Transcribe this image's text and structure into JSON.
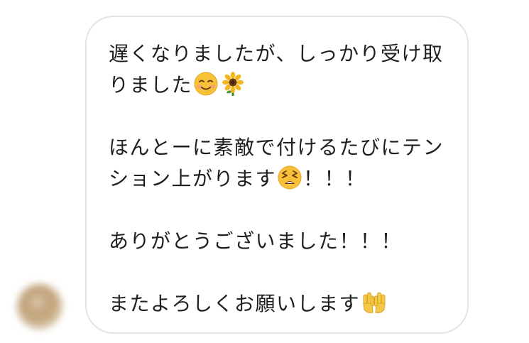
{
  "message": {
    "paragraphs": [
      {
        "lines": [
          "遅くなりましたが、しっかり受け取",
          "りました"
        ],
        "emojis": [
          "smiling-face-emoji",
          "sunflower-emoji"
        ]
      },
      {
        "lines": [
          "ほんとーに素敵で付けるたびにテン",
          "ション上がります"
        ],
        "emojis": [
          "tired-face-emoji"
        ],
        "suffix": "！！！"
      },
      {
        "lines": [
          "ありがとうございました！！！"
        ]
      },
      {
        "lines": [
          "またよろしくお願いします"
        ],
        "emojis": [
          "palms-up-together-emoji"
        ]
      }
    ]
  },
  "colors": {
    "text": "#1f1f1f",
    "bubble_border": "#e3e3e3",
    "background": "#ffffff"
  }
}
